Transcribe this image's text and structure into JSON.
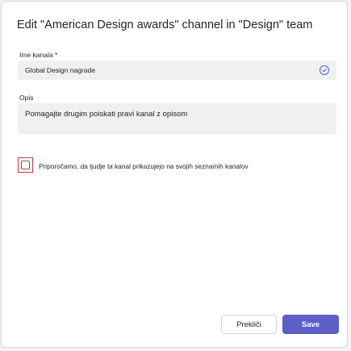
{
  "dialog": {
    "title": "Edit \"American Design awards\" channel in \"Design\" team",
    "name_label": "Ime kanala *",
    "name_value": "Global Design nagrade",
    "description_label": "Opis",
    "description_value": "Pomagajte drugim poiskati pravi kanal z opisom",
    "checkbox_label": "Priporočamo, da ljudje ta kanal prikazujejo na svojih seznamih kanalov",
    "checkbox_checked": false,
    "cancel_label": "Prekliči",
    "save_label": "Save"
  },
  "colors": {
    "accent": "#5b5fc7",
    "focus_outline": "#d13438"
  },
  "icons": {
    "name_valid": "check-circle-icon"
  }
}
